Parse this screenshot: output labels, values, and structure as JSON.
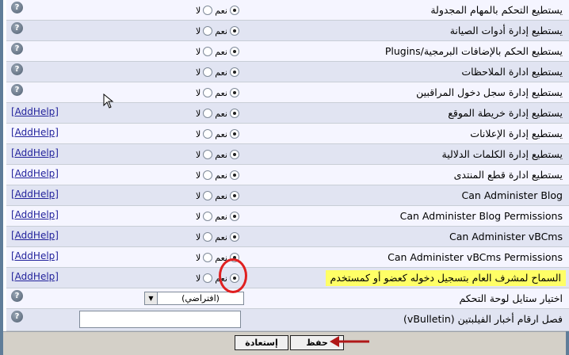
{
  "options": {
    "yes": "نعم",
    "no": "لا"
  },
  "help_link": "[AddHelp]",
  "help_icon": "help-icon",
  "rows": [
    {
      "label": "يستطيع التحكم بالمهام المجدولة",
      "help": "icon",
      "selected": "yes"
    },
    {
      "label": "يستطيع إدارة أدوات الصيانة",
      "help": "icon",
      "selected": "yes"
    },
    {
      "label": "يستطيع الحكم بالإضافات البرمجية/Plugins",
      "help": "icon",
      "selected": "yes"
    },
    {
      "label": "يستطيع ادارة الملاحظات",
      "help": "icon",
      "selected": "yes"
    },
    {
      "label": "يستطيع إدارة سجل دخول المراقبين",
      "help": "icon",
      "selected": "yes"
    },
    {
      "label": "يستطيع إدارة خريطة الموقع",
      "help": "link",
      "selected": "yes"
    },
    {
      "label": "يستطيع إدارة الإعلانات",
      "help": "link",
      "selected": "yes"
    },
    {
      "label": "يستطيع إدارة الكلمات الدلالية",
      "help": "link",
      "selected": "yes"
    },
    {
      "label": "يستطيع ادارة قطع المنتدى",
      "help": "link",
      "selected": "yes"
    },
    {
      "label": "Can Administer Blog",
      "help": "link",
      "selected": "yes"
    },
    {
      "label": "Can Administer Blog Permissions",
      "help": "link",
      "selected": "yes"
    },
    {
      "label": "Can Administer vBCms",
      "help": "link",
      "selected": "yes"
    },
    {
      "label": "Can Administer vBCms Permissions",
      "help": "link",
      "selected": "yes"
    },
    {
      "label": "السماح لمشرف العام بتسجيل دخوله كعضو أو كمستخدم",
      "help": "link",
      "selected": "yes",
      "highlight": true
    }
  ],
  "style_row": {
    "label": "اختيار ستايل لوحة التحكم",
    "selected_value": "(افتراضي)"
  },
  "news_row": {
    "label": "فصل ارقام أخبار الفيلبتين (vBulletin)",
    "value": ""
  },
  "buttons": {
    "save": "حفظ",
    "reset": "إستعادة"
  },
  "colors": {
    "frame": "#5f7d99",
    "highlight": "#ffff66",
    "annotation": "#e02020",
    "link": "#22229c"
  }
}
